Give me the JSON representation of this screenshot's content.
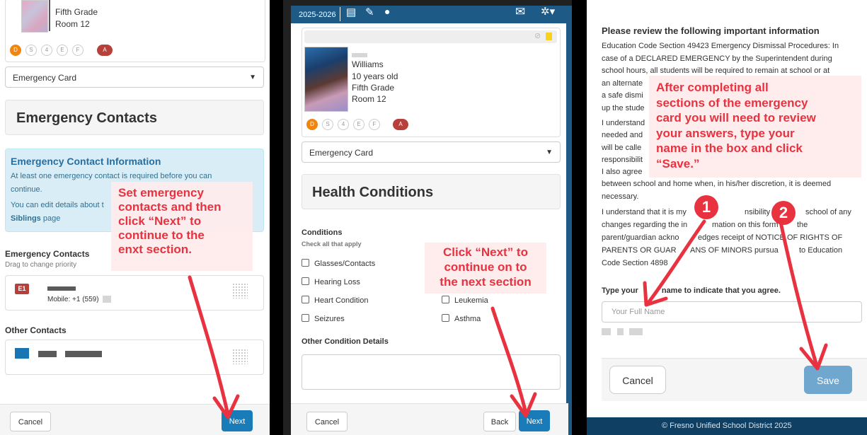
{
  "panel1": {
    "student": {
      "grade": "Fifth Grade",
      "room": "Room 12"
    },
    "chips": [
      "D",
      "S",
      "4",
      "E",
      "F",
      "A"
    ],
    "card_select": "Emergency Card",
    "section_title": "Emergency Contacts",
    "info": {
      "title": "Emergency Contact Information",
      "line1": "At least one emergency contact is required before you can",
      "line2": "continue.",
      "line3": "You can edit details about t",
      "siblings_bold": "Siblings",
      "siblings_rest": " page"
    },
    "contacts_heading": "Emergency Contacts",
    "contacts_sub": "Drag to change priority",
    "contact1": {
      "badge": "E1",
      "phone": "Mobile: +1 (559)"
    },
    "other_heading": "Other Contacts",
    "cancel": "Cancel",
    "next": "Next",
    "callout": [
      "Set emergency",
      "contacts and then",
      "click “Next” to",
      "continue to the",
      "enxt section."
    ]
  },
  "panel2": {
    "header": {
      "year": "2025-2026"
    },
    "student": {
      "name": "Williams",
      "age": "10 years old",
      "grade": "Fifth Grade",
      "room": "Room 12"
    },
    "chips": [
      "D",
      "S",
      "4",
      "E",
      "F",
      "A"
    ],
    "card_select": "Emergency Card",
    "section_title": "Health Conditions",
    "conditions_heading": "Conditions",
    "conditions_sub": "Check all that apply",
    "conditions_left": [
      "Glasses/Contacts",
      "Hearing Loss",
      "Heart Condition",
      "Seizures"
    ],
    "conditions_right": [
      "Leukemia",
      "Asthma"
    ],
    "details_heading": "Other Condition Details",
    "cancel": "Cancel",
    "back": "Back",
    "next": "Next",
    "callout": [
      "Click “Next” to",
      "continue on to",
      "the next section"
    ]
  },
  "panel3": {
    "title": "Please review the following important information",
    "paragraph1": [
      "Education Code Section 49423 Emergency Dismissal Procedures: In",
      "case of a DECLARED EMERGENCY by the Superintendent during",
      "school hours, all students will be required to remain at school or at",
      "an alternate",
      "a safe dismi",
      "up the stude"
    ],
    "paragraph2": [
      "I understand",
      "needed and",
      "will be calle",
      "responsibilit",
      "I also agree",
      "between school and home when, in his/her discretion, it is deemed",
      "necessary."
    ],
    "paragraph3": [
      "I understand that it is my",
      "nsibility to info",
      "school of any",
      "changes regarding the in",
      "mation on this form",
      "the",
      "parent/guardian ackno",
      "edges receipt of NOTICE OF RIGHTS OF",
      "PARENTS OR GUAR",
      "ANS OF MINORS pursua",
      "to Education",
      "Code Section 4898"
    ],
    "agree_label_a": "Type your",
    "agree_label_b": "name to indicate that you agree.",
    "name_placeholder": "Your Full Name",
    "cancel": "Cancel",
    "save": "Save",
    "footer": "© Fresno Unified School District 2025",
    "callout": [
      "After completing all",
      "sections of the emergency",
      "card you will need to review",
      "your answers, type your",
      "name in the box and click",
      "“Save.”"
    ],
    "badges": [
      "1",
      "2"
    ]
  },
  "colors": {
    "primary": "#1a7bb9",
    "annotation": "#e8323f",
    "nav": "#1d5a86",
    "footer_dark": "#0f3f63"
  }
}
